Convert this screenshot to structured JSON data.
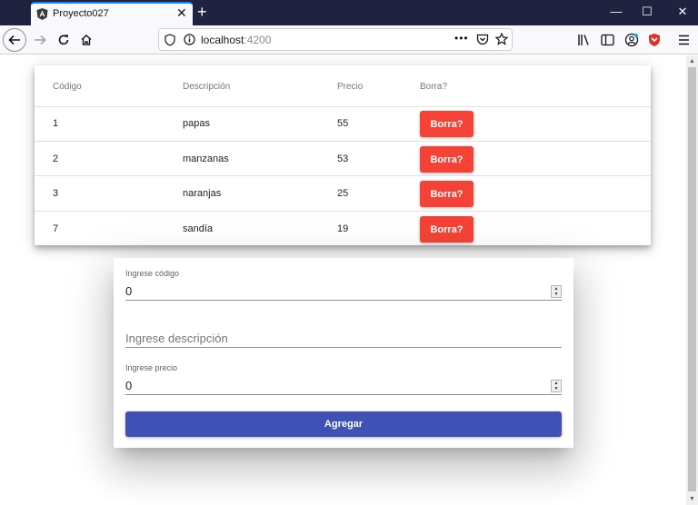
{
  "browser": {
    "tab_title": "Proyecto027",
    "url_host": "localhost",
    "url_port": ":4200"
  },
  "table": {
    "headers": [
      "Código",
      "Descripción",
      "Precio",
      "Borra?"
    ],
    "rows": [
      {
        "codigo": "1",
        "descripcion": "papas",
        "precio": "55",
        "action": "Borra?"
      },
      {
        "codigo": "2",
        "descripcion": "manzanas",
        "precio": "53",
        "action": "Borra?"
      },
      {
        "codigo": "3",
        "descripcion": "naranjas",
        "precio": "25",
        "action": "Borra?"
      },
      {
        "codigo": "7",
        "descripcion": "sandía",
        "precio": "19",
        "action": "Borra?"
      }
    ]
  },
  "form": {
    "codigo_label": "Ingrese código",
    "codigo_value": "0",
    "descripcion_placeholder": "Ingrese descripción",
    "precio_label": "Ingrese precio",
    "precio_value": "0",
    "submit_label": "Agregar"
  },
  "colors": {
    "delete_button": "#f44336",
    "primary_button": "#3f51b5",
    "titlebar": "#202340"
  }
}
